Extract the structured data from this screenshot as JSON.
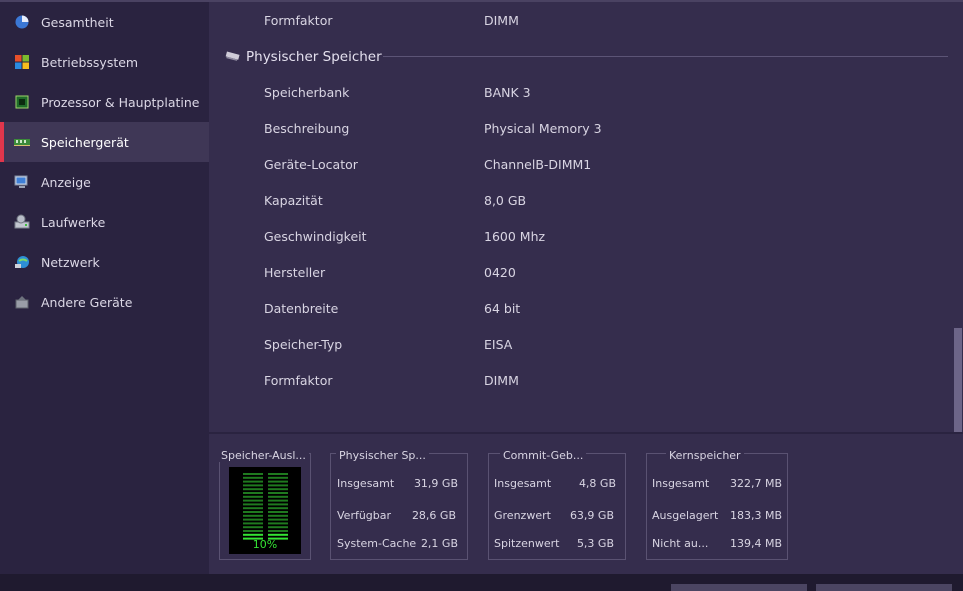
{
  "sidebar": {
    "items": [
      {
        "label": "Gesamtheit",
        "icon": "pie-chart-icon"
      },
      {
        "label": "Betriebssystem",
        "icon": "windows-logo-icon"
      },
      {
        "label": "Prozessor & Hauptplatine",
        "icon": "cpu-chip-icon"
      },
      {
        "label": "Speichergerät",
        "icon": "ram-module-icon",
        "active": true
      },
      {
        "label": "Anzeige",
        "icon": "monitor-icon"
      },
      {
        "label": "Laufwerke",
        "icon": "drive-icon"
      },
      {
        "label": "Netzwerk",
        "icon": "network-icon"
      },
      {
        "label": "Andere Geräte",
        "icon": "device-icon"
      }
    ]
  },
  "main": {
    "top_row": {
      "label": "Formfaktor",
      "value": "DIMM"
    },
    "section_title": "Physischer Speicher",
    "rows": [
      {
        "label": "Speicherbank",
        "value": "BANK 3"
      },
      {
        "label": "Beschreibung",
        "value": "Physical Memory 3"
      },
      {
        "label": "Geräte-Locator",
        "value": "ChannelB-DIMM1"
      },
      {
        "label": "Kapazität",
        "value": "8,0 GB"
      },
      {
        "label": "Geschwindigkeit",
        "value": "1600 Mhz"
      },
      {
        "label": "Hersteller",
        "value": "0420"
      },
      {
        "label": "Datenbreite",
        "value": "64 bit"
      },
      {
        "label": "Speicher-Typ",
        "value": "EISA"
      },
      {
        "label": "Formfaktor",
        "value": "DIMM"
      }
    ]
  },
  "bottom": {
    "usage": {
      "title": "Speicher-Ausl...",
      "percent_label": "10%",
      "percent": 10
    },
    "physical": {
      "title": "Physischer Sp...",
      "rows": [
        {
          "label": "Insgesamt",
          "value": "31,9 GB"
        },
        {
          "label": "Verfügbar",
          "value": "28,6 GB"
        },
        {
          "label": "System-Cache",
          "value": "2,1 GB"
        }
      ]
    },
    "commit": {
      "title": "Commit-Geb...",
      "rows": [
        {
          "label": "Insgesamt",
          "value": "4,8 GB"
        },
        {
          "label": "Grenzwert",
          "value": "63,9 GB"
        },
        {
          "label": "Spitzenwert",
          "value": "5,3 GB"
        }
      ]
    },
    "kernel": {
      "title": "Kernspeicher",
      "rows": [
        {
          "label": "Insgesamt",
          "value": "322,7 MB"
        },
        {
          "label": "Ausgelagert",
          "value": "183,3 MB"
        },
        {
          "label": "Nicht au...",
          "value": "139,4 MB"
        }
      ]
    }
  },
  "colors": {
    "accent": "#e0364c",
    "meter_green": "#34e334",
    "background": "#352d4d",
    "sidebar": "#2a2340"
  }
}
